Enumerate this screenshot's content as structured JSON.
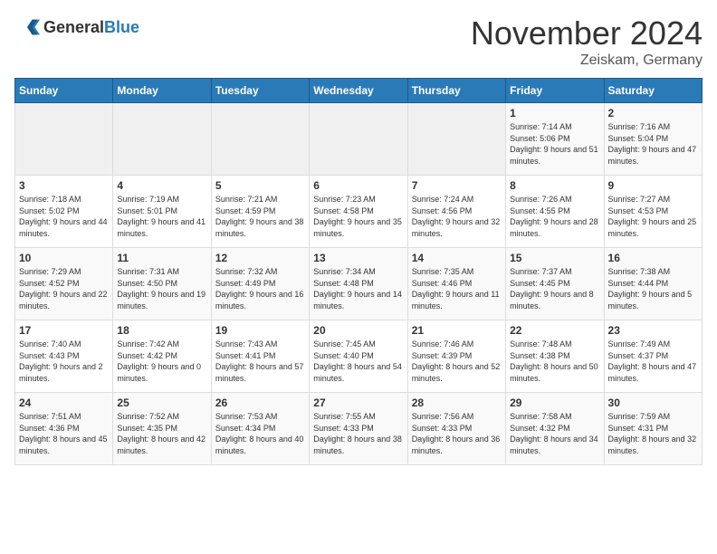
{
  "logo": {
    "general": "General",
    "blue": "Blue"
  },
  "header": {
    "month": "November 2024",
    "location": "Zeiskam, Germany"
  },
  "days_of_week": [
    "Sunday",
    "Monday",
    "Tuesday",
    "Wednesday",
    "Thursday",
    "Friday",
    "Saturday"
  ],
  "weeks": [
    [
      {
        "day": "",
        "info": ""
      },
      {
        "day": "",
        "info": ""
      },
      {
        "day": "",
        "info": ""
      },
      {
        "day": "",
        "info": ""
      },
      {
        "day": "",
        "info": ""
      },
      {
        "day": "1",
        "info": "Sunrise: 7:14 AM\nSunset: 5:06 PM\nDaylight: 9 hours and 51 minutes."
      },
      {
        "day": "2",
        "info": "Sunrise: 7:16 AM\nSunset: 5:04 PM\nDaylight: 9 hours and 47 minutes."
      }
    ],
    [
      {
        "day": "3",
        "info": "Sunrise: 7:18 AM\nSunset: 5:02 PM\nDaylight: 9 hours and 44 minutes."
      },
      {
        "day": "4",
        "info": "Sunrise: 7:19 AM\nSunset: 5:01 PM\nDaylight: 9 hours and 41 minutes."
      },
      {
        "day": "5",
        "info": "Sunrise: 7:21 AM\nSunset: 4:59 PM\nDaylight: 9 hours and 38 minutes."
      },
      {
        "day": "6",
        "info": "Sunrise: 7:23 AM\nSunset: 4:58 PM\nDaylight: 9 hours and 35 minutes."
      },
      {
        "day": "7",
        "info": "Sunrise: 7:24 AM\nSunset: 4:56 PM\nDaylight: 9 hours and 32 minutes."
      },
      {
        "day": "8",
        "info": "Sunrise: 7:26 AM\nSunset: 4:55 PM\nDaylight: 9 hours and 28 minutes."
      },
      {
        "day": "9",
        "info": "Sunrise: 7:27 AM\nSunset: 4:53 PM\nDaylight: 9 hours and 25 minutes."
      }
    ],
    [
      {
        "day": "10",
        "info": "Sunrise: 7:29 AM\nSunset: 4:52 PM\nDaylight: 9 hours and 22 minutes."
      },
      {
        "day": "11",
        "info": "Sunrise: 7:31 AM\nSunset: 4:50 PM\nDaylight: 9 hours and 19 minutes."
      },
      {
        "day": "12",
        "info": "Sunrise: 7:32 AM\nSunset: 4:49 PM\nDaylight: 9 hours and 16 minutes."
      },
      {
        "day": "13",
        "info": "Sunrise: 7:34 AM\nSunset: 4:48 PM\nDaylight: 9 hours and 14 minutes."
      },
      {
        "day": "14",
        "info": "Sunrise: 7:35 AM\nSunset: 4:46 PM\nDaylight: 9 hours and 11 minutes."
      },
      {
        "day": "15",
        "info": "Sunrise: 7:37 AM\nSunset: 4:45 PM\nDaylight: 9 hours and 8 minutes."
      },
      {
        "day": "16",
        "info": "Sunrise: 7:38 AM\nSunset: 4:44 PM\nDaylight: 9 hours and 5 minutes."
      }
    ],
    [
      {
        "day": "17",
        "info": "Sunrise: 7:40 AM\nSunset: 4:43 PM\nDaylight: 9 hours and 2 minutes."
      },
      {
        "day": "18",
        "info": "Sunrise: 7:42 AM\nSunset: 4:42 PM\nDaylight: 9 hours and 0 minutes."
      },
      {
        "day": "19",
        "info": "Sunrise: 7:43 AM\nSunset: 4:41 PM\nDaylight: 8 hours and 57 minutes."
      },
      {
        "day": "20",
        "info": "Sunrise: 7:45 AM\nSunset: 4:40 PM\nDaylight: 8 hours and 54 minutes."
      },
      {
        "day": "21",
        "info": "Sunrise: 7:46 AM\nSunset: 4:39 PM\nDaylight: 8 hours and 52 minutes."
      },
      {
        "day": "22",
        "info": "Sunrise: 7:48 AM\nSunset: 4:38 PM\nDaylight: 8 hours and 50 minutes."
      },
      {
        "day": "23",
        "info": "Sunrise: 7:49 AM\nSunset: 4:37 PM\nDaylight: 8 hours and 47 minutes."
      }
    ],
    [
      {
        "day": "24",
        "info": "Sunrise: 7:51 AM\nSunset: 4:36 PM\nDaylight: 8 hours and 45 minutes."
      },
      {
        "day": "25",
        "info": "Sunrise: 7:52 AM\nSunset: 4:35 PM\nDaylight: 8 hours and 42 minutes."
      },
      {
        "day": "26",
        "info": "Sunrise: 7:53 AM\nSunset: 4:34 PM\nDaylight: 8 hours and 40 minutes."
      },
      {
        "day": "27",
        "info": "Sunrise: 7:55 AM\nSunset: 4:33 PM\nDaylight: 8 hours and 38 minutes."
      },
      {
        "day": "28",
        "info": "Sunrise: 7:56 AM\nSunset: 4:33 PM\nDaylight: 8 hours and 36 minutes."
      },
      {
        "day": "29",
        "info": "Sunrise: 7:58 AM\nSunset: 4:32 PM\nDaylight: 8 hours and 34 minutes."
      },
      {
        "day": "30",
        "info": "Sunrise: 7:59 AM\nSunset: 4:31 PM\nDaylight: 8 hours and 32 minutes."
      }
    ]
  ]
}
